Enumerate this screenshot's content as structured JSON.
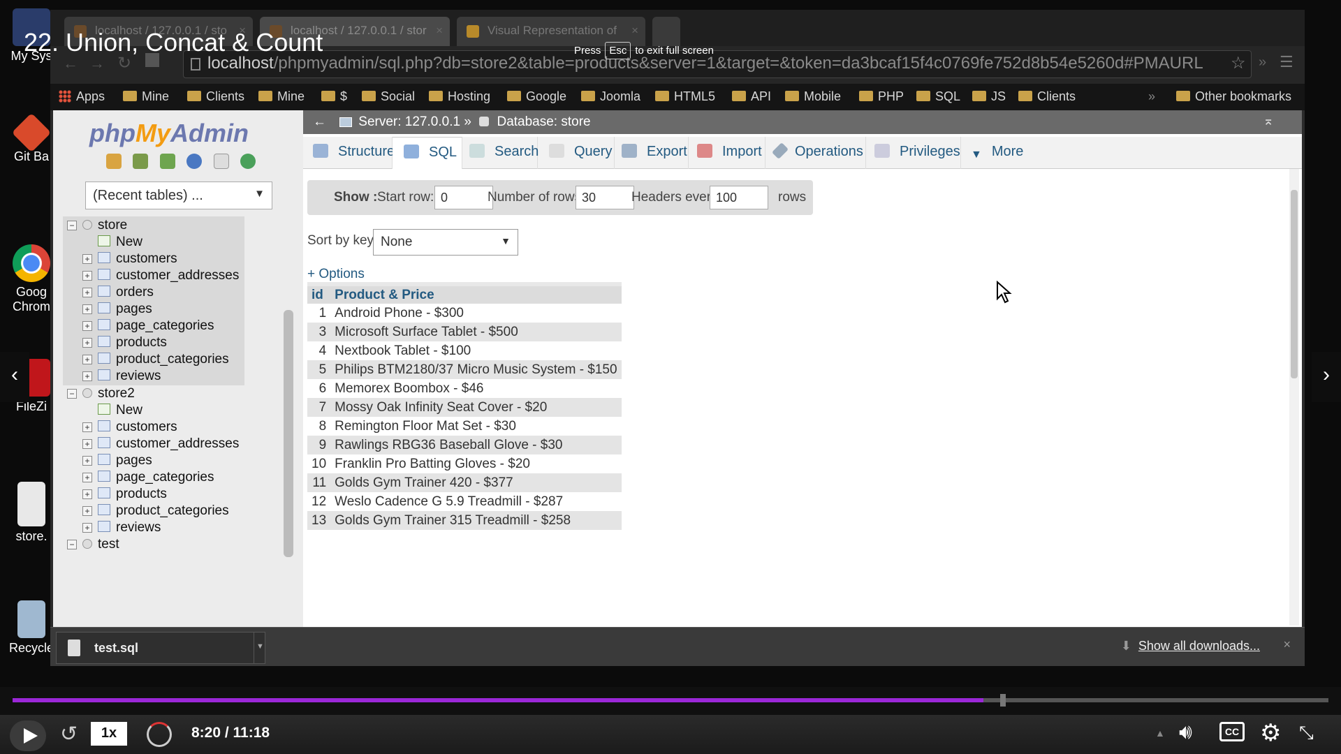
{
  "video": {
    "title": "22. Union, Concat & Count",
    "esc_press": "Press",
    "esc_key": "Esc",
    "esc_suffix": "to exit full screen",
    "time": "8:20 / 11:18",
    "speed": "1x",
    "progress_fraction": 0.738
  },
  "desktop": {
    "icons": [
      {
        "label": "My Sys",
        "icon": "computer-icon"
      },
      {
        "label": "Git Ba",
        "icon": "git-icon"
      },
      {
        "label": "Goog Chrom",
        "icon": "chrome-icon"
      },
      {
        "label": "FileZi",
        "icon": "filezilla-icon"
      },
      {
        "label": "store.",
        "icon": "file-icon"
      },
      {
        "label": "Recycle",
        "icon": "recycle-bin-icon"
      }
    ]
  },
  "browser": {
    "tabs": [
      {
        "title": "localhost / 127.0.0.1 / sto"
      },
      {
        "title": "localhost / 127.0.0.1 / stor"
      },
      {
        "title": "Visual Representation of"
      }
    ],
    "url_host": "localhost",
    "url_rest": "/phpmyadmin/sql.php?db=store2&table=products&server=1&target=&token=da3bcaf15f4c0769fe752d8b54e5260d#PMAURL",
    "bookmarks": [
      {
        "label": "Apps",
        "icon": "apps-icon"
      },
      {
        "label": "Mine",
        "icon": "folder-icon"
      },
      {
        "label": "Clients",
        "icon": "folder-icon"
      },
      {
        "label": "Mine",
        "icon": "folder-icon"
      },
      {
        "label": "$",
        "icon": "folder-icon"
      },
      {
        "label": "Social",
        "icon": "folder-icon"
      },
      {
        "label": "Hosting",
        "icon": "folder-icon"
      },
      {
        "label": "Google",
        "icon": "folder-icon"
      },
      {
        "label": "Joomla",
        "icon": "folder-icon"
      },
      {
        "label": "HTML5",
        "icon": "folder-icon"
      },
      {
        "label": "API",
        "icon": "folder-icon"
      },
      {
        "label": "Mobile",
        "icon": "folder-icon"
      },
      {
        "label": "PHP",
        "icon": "folder-icon"
      },
      {
        "label": "SQL",
        "icon": "folder-icon"
      },
      {
        "label": "JS",
        "icon": "folder-icon"
      },
      {
        "label": "Clients",
        "icon": "folder-icon"
      }
    ],
    "other_bookmarks": "Other bookmarks",
    "overflow": "»"
  },
  "pma": {
    "logo_php": "php",
    "logo_my": "My",
    "logo_admin": "Admin",
    "recent_tables": "(Recent tables) ...",
    "tree": {
      "db1": "store",
      "db1_items": [
        "New",
        "customers",
        "customer_addresses",
        "orders",
        "pages",
        "page_categories",
        "products",
        "product_categories",
        "reviews"
      ],
      "db2": "store2",
      "db2_items": [
        "New",
        "customers",
        "customer_addresses",
        "pages",
        "page_categories",
        "products",
        "product_categories",
        "reviews"
      ],
      "db3": "test"
    },
    "breadcrumb": {
      "server": "Server: 127.0.0.1",
      "sep": "»",
      "database": "Database: store"
    },
    "tabs": [
      {
        "label": "Structure",
        "icon": "structure-icon"
      },
      {
        "label": "SQL",
        "icon": "sql-icon"
      },
      {
        "label": "Search",
        "icon": "search-icon"
      },
      {
        "label": "Query",
        "icon": "query-icon"
      },
      {
        "label": "Export",
        "icon": "export-icon"
      },
      {
        "label": "Import",
        "icon": "import-icon"
      },
      {
        "label": "Operations",
        "icon": "wrench-icon"
      },
      {
        "label": "Privileges",
        "icon": "privileges-icon"
      },
      {
        "label": "More",
        "icon": "chevron-down-icon"
      }
    ],
    "show": {
      "show_label": "Show :",
      "start_row_label": "Start row:",
      "start_row": "0",
      "num_rows_label": "Number of rows:",
      "num_rows": "30",
      "headers_label": "Headers every",
      "headers": "100",
      "rows_label": "rows"
    },
    "sort_label": "Sort by key:",
    "sort_value": "None",
    "options_link": "+ Options",
    "results": {
      "headers": [
        "id",
        "Product & Price"
      ],
      "rows": [
        [
          "1",
          "Android Phone - $300"
        ],
        [
          "3",
          "Microsoft Surface Tablet - $500"
        ],
        [
          "4",
          "Nextbook Tablet - $100"
        ],
        [
          "5",
          "Philips BTM2180/37 Micro Music System - $150"
        ],
        [
          "6",
          "Memorex Boombox - $46"
        ],
        [
          "7",
          "Mossy Oak Infinity Seat Cover - $20"
        ],
        [
          "8",
          "Remington Floor Mat Set - $30"
        ],
        [
          "9",
          "Rawlings RBG36 Baseball Glove - $30"
        ],
        [
          "10",
          "Franklin Pro Batting Gloves - $20"
        ],
        [
          "11",
          "Golds Gym Trainer 420 - $377"
        ],
        [
          "12",
          "Weslo Cadence G 5.9 Treadmill - $287"
        ],
        [
          "13",
          "Golds Gym Trainer 315 Treadmill - $258"
        ]
      ]
    }
  },
  "downloads": {
    "file": "test.sql",
    "show_all": "Show all downloads...",
    "close": "×"
  },
  "colors": {
    "accent_purple": "#9b27d8",
    "pma_link": "#235a81"
  }
}
